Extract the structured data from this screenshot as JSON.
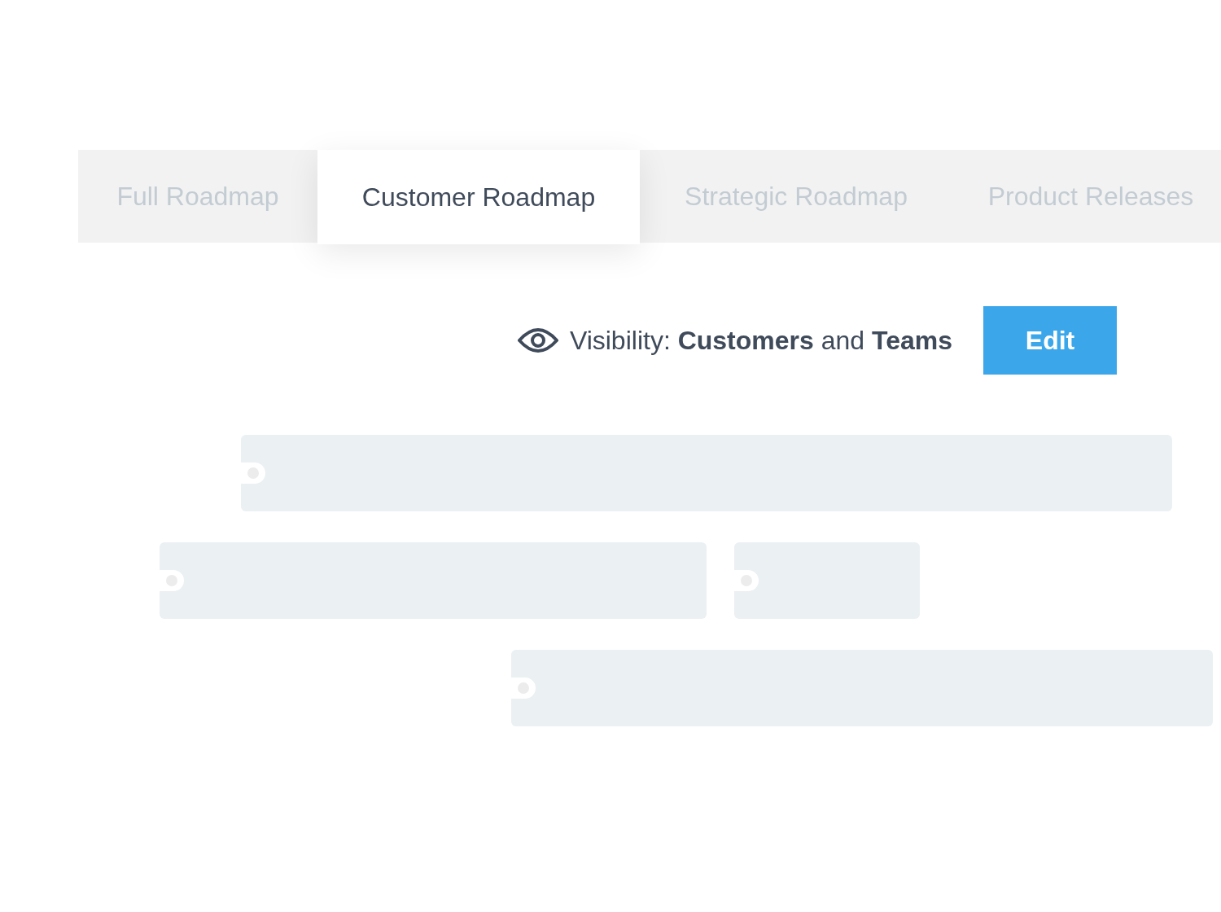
{
  "tabs": [
    {
      "label": "Full Roadmap",
      "selected": false
    },
    {
      "label": "Customer Roadmap",
      "selected": true
    },
    {
      "label": "Strategic Roadmap",
      "selected": false
    },
    {
      "label": "Product Releases",
      "selected": false
    }
  ],
  "visibility": {
    "text": "Visibility: **Customers** and **Teams**",
    "button": "Edit"
  }
}
